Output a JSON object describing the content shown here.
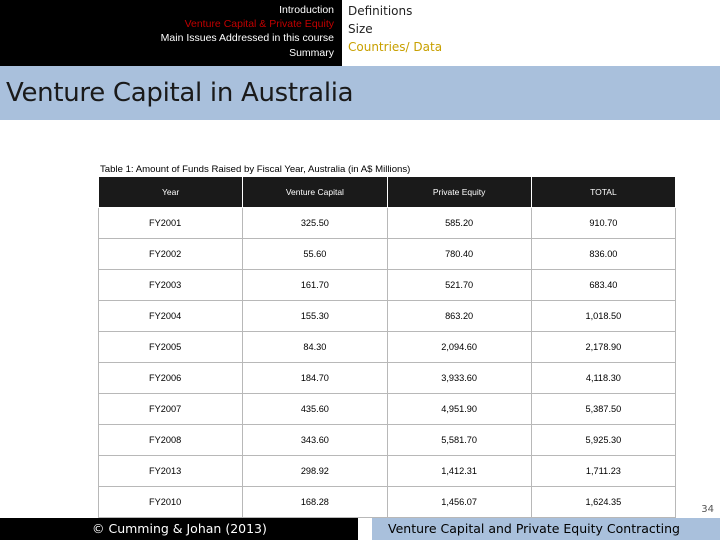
{
  "nav": {
    "items": [
      {
        "label": "Introduction",
        "active": false
      },
      {
        "label": "Venture Capital & Private Equity",
        "active": true
      },
      {
        "label": "Main Issues Addressed in this course",
        "active": false
      },
      {
        "label": "Summary",
        "active": false
      }
    ]
  },
  "subnav": {
    "items": [
      {
        "label": "Definitions",
        "active": false
      },
      {
        "label": "Size",
        "active": false
      },
      {
        "label": "Countries/ Data",
        "active": true
      }
    ]
  },
  "page": {
    "title": "Venture Capital in Australia",
    "slide_number": "34"
  },
  "table": {
    "caption": "Table 1: Amount of Funds Raised by Fiscal Year, Australia (in A$ Millions)",
    "columns": [
      "Year",
      "Venture Capital",
      "Private Equity",
      "TOTAL"
    ],
    "rows": [
      [
        "FY2001",
        "325.50",
        "585.20",
        "910.70"
      ],
      [
        "FY2002",
        "55.60",
        "780.40",
        "836.00"
      ],
      [
        "FY2003",
        "161.70",
        "521.70",
        "683.40"
      ],
      [
        "FY2004",
        "155.30",
        "863.20",
        "1,018.50"
      ],
      [
        "FY2005",
        "84.30",
        "2,094.60",
        "2,178.90"
      ],
      [
        "FY2006",
        "184.70",
        "3,933.60",
        "4,118.30"
      ],
      [
        "FY2007",
        "435.60",
        "4,951.90",
        "5,387.50"
      ],
      [
        "FY2008",
        "343.60",
        "5,581.70",
        "5,925.30"
      ],
      [
        "FY2013",
        "298.92",
        "1,412.31",
        "1,711.23"
      ],
      [
        "FY2010",
        "168.28",
        "1,456.07",
        "1,624.35"
      ]
    ]
  },
  "footer": {
    "left_text": "© Cumming & Johan (2013)",
    "right_text": "Venture Capital and Private Equity Contracting"
  },
  "colors": {
    "accent_red": "#c00000",
    "accent_gold": "#c8a000",
    "band_blue": "#a9c0dc",
    "dark": "#000000"
  }
}
